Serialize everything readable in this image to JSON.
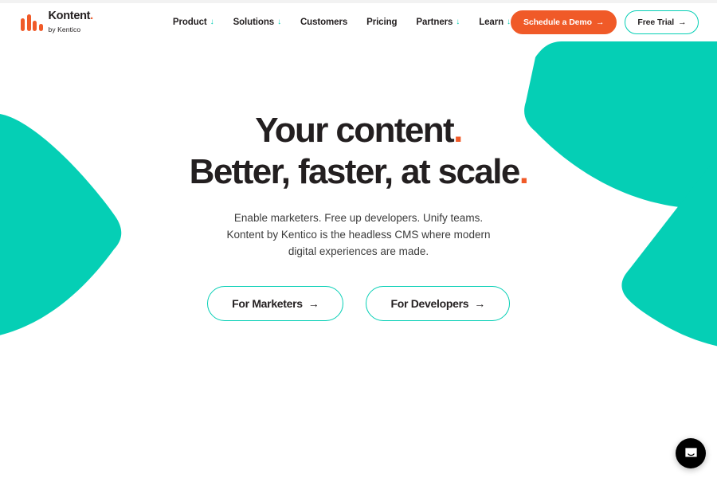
{
  "site": {
    "brand_name": "Kontent",
    "brand_dot": ".",
    "brand_tagline": "by Kentico"
  },
  "colors": {
    "teal": "#05CFB5",
    "orange": "#F05A28",
    "ink": "#231F20",
    "background": "#FFFFFF"
  },
  "header": {
    "nav": [
      {
        "label": "Product",
        "caret": "↓",
        "has_caret": true
      },
      {
        "label": "Solutions",
        "caret": "↓",
        "has_caret": true
      },
      {
        "label": "Customers",
        "caret": "",
        "has_caret": false
      },
      {
        "label": "Pricing",
        "caret": "",
        "has_caret": false
      },
      {
        "label": "Partners",
        "caret": "↓",
        "has_caret": true
      },
      {
        "label": "Learn",
        "caret": "↓",
        "has_caret": true
      }
    ],
    "demo_button": "Schedule a Demo",
    "demo_arrow": "→",
    "trial_button": "Free Trial",
    "trial_arrow": "→"
  },
  "hero": {
    "headline_line1": "Your content",
    "headline_line1_dot": ".",
    "headline_line2": "Better, faster, at scale",
    "headline_line2_dot": ".",
    "subhead": "Enable marketers. Free up developers. Unify teams. Kontent by Kentico is the headless CMS where modern digital experiences are made.",
    "cta_marketers": "For Marketers",
    "cta_marketers_arrow": "→",
    "cta_developers": "For Developers",
    "cta_developers_arrow": "→"
  },
  "chat": {
    "icon": "chat-bubble-icon"
  }
}
